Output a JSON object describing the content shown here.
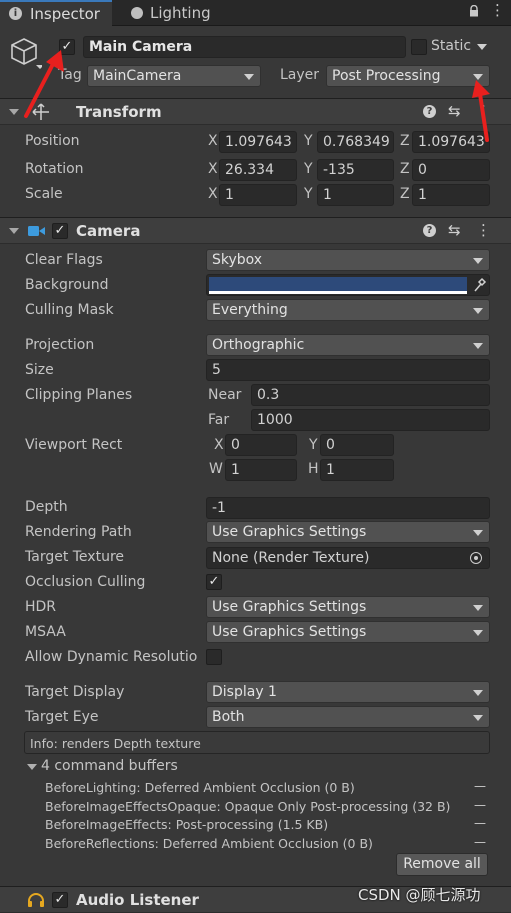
{
  "tabs": {
    "inspector": "Inspector",
    "lighting": "Lighting"
  },
  "object": {
    "name": "Main Camera",
    "static_label": "Static",
    "tag_label": "Tag",
    "tag_value": "MainCamera",
    "layer_label": "Layer",
    "layer_value": "Post Processing"
  },
  "transform": {
    "title": "Transform",
    "position_label": "Position",
    "rotation_label": "Rotation",
    "scale_label": "Scale",
    "axes": {
      "x": "X",
      "y": "Y",
      "z": "Z"
    },
    "position": {
      "x": "1.097643",
      "y": "0.768349",
      "z": "1.097643"
    },
    "rotation": {
      "x": "26.334",
      "y": "-135",
      "z": "0"
    },
    "scale": {
      "x": "1",
      "y": "1",
      "z": "1"
    }
  },
  "camera": {
    "title": "Camera",
    "clear_flags": {
      "label": "Clear Flags",
      "value": "Skybox"
    },
    "background": {
      "label": "Background",
      "color": "#2d4a7a"
    },
    "culling_mask": {
      "label": "Culling Mask",
      "value": "Everything"
    },
    "projection": {
      "label": "Projection",
      "value": "Orthographic"
    },
    "size": {
      "label": "Size",
      "value": "5"
    },
    "clipping": {
      "label": "Clipping Planes",
      "near_label": "Near",
      "near": "0.3",
      "far_label": "Far",
      "far": "1000"
    },
    "viewport": {
      "label": "Viewport Rect",
      "x_label": "X",
      "x": "0",
      "y_label": "Y",
      "y": "0",
      "w_label": "W",
      "w": "1",
      "h_label": "H",
      "h": "1"
    },
    "depth": {
      "label": "Depth",
      "value": "-1"
    },
    "rendering_path": {
      "label": "Rendering Path",
      "value": "Use Graphics Settings"
    },
    "target_texture": {
      "label": "Target Texture",
      "value": "None (Render Texture)"
    },
    "occlusion": {
      "label": "Occlusion Culling",
      "check": "✓"
    },
    "hdr": {
      "label": "HDR",
      "value": "Use Graphics Settings"
    },
    "msaa": {
      "label": "MSAA",
      "value": "Use Graphics Settings"
    },
    "dynamic_resolution": {
      "label": "Allow Dynamic Resolutio"
    },
    "target_display": {
      "label": "Target Display",
      "value": "Display 1"
    },
    "target_eye": {
      "label": "Target Eye",
      "value": "Both"
    },
    "info": "Info: renders Depth texture",
    "command_buffers": {
      "title": "4 command buffers",
      "items": [
        "BeforeLighting: Deferred Ambient Occlusion (0 B)",
        "BeforeImageEffectsOpaque: Opaque Only Post-processing (32 B)",
        "BeforeImageEffects: Post-processing (1.5 KB)",
        "BeforeReflections: Deferred Ambient Occlusion (0 B)"
      ],
      "remove_symbol": "—",
      "remove_all": "Remove all"
    }
  },
  "audio_listener": {
    "title": "Audio Listener"
  },
  "watermark": "CSDN @顾七源功",
  "colors": {
    "annotation_arrow": "#e8201e",
    "background_swatch": "#2d4a7a"
  }
}
